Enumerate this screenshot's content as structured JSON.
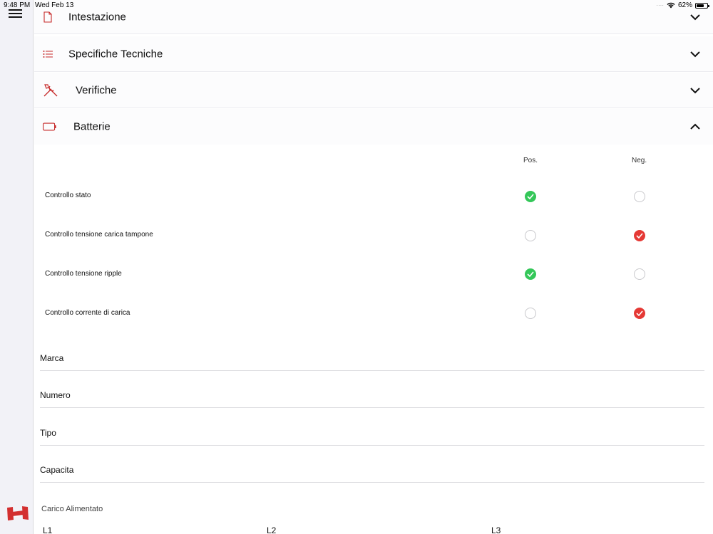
{
  "status_bar": {
    "time": "9:48 PM",
    "date": "Wed Feb 13",
    "battery": "62%",
    "battery_level": 0.62
  },
  "sidebar": {
    "menu_icon": "hamburger-icon",
    "logo": "app-logo"
  },
  "sections": [
    {
      "title": "Intestazione",
      "icon": "document-icon",
      "expanded": false
    },
    {
      "title": "Specifiche Tecniche",
      "icon": "list-icon",
      "expanded": false
    },
    {
      "title": "Verifiche",
      "icon": "tools-icon",
      "expanded": false
    },
    {
      "title": "Batterie",
      "icon": "battery-icon",
      "expanded": true
    }
  ],
  "batterie": {
    "columns": {
      "pos": "Pos.",
      "neg": "Neg."
    },
    "checks": [
      {
        "label": "Controllo stato",
        "selected": "pos"
      },
      {
        "label": "Controllo tensione carica tampone",
        "selected": "neg"
      },
      {
        "label": "Controllo tensione ripple",
        "selected": "pos"
      },
      {
        "label": "Controllo corrente di carica",
        "selected": "neg"
      }
    ],
    "fields": [
      {
        "label": "Marca",
        "value": ""
      },
      {
        "label": "Numero",
        "value": ""
      },
      {
        "label": "Tipo",
        "value": ""
      },
      {
        "label": "Capacita",
        "value": ""
      }
    ],
    "carico_title": "Carico Alimentato",
    "carico_cols": [
      "L1",
      "L2",
      "L3"
    ]
  },
  "colors": {
    "accent": "#c62828",
    "positive": "#34c759",
    "negative": "#e53935"
  }
}
